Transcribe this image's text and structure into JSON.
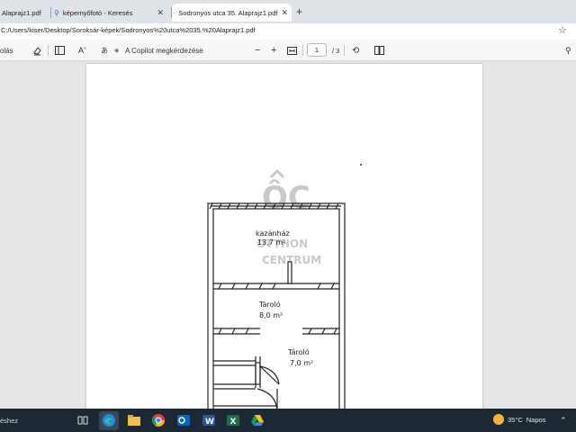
{
  "tabs": [
    {
      "label": "Alaprajz1.pdf",
      "icon": "pdf-icon",
      "active": false
    },
    {
      "label": "képernyőfotó - Keresés",
      "icon": "search-icon",
      "active": false
    },
    {
      "label": "Sodronyos utca 35. Alaprajz1.pdf",
      "icon": "pdf-icon",
      "active": true
    }
  ],
  "address": {
    "url": "C:/Users/kiser/Desktop/Soroksár-képek/Sodronyos%20utca%2035.%20Alaprajz1.pdf"
  },
  "pdf_toolbar": {
    "left_label": "olás",
    "copilot_label": "A Copilot megkérdezése",
    "zoom_out": "−",
    "zoom_in": "+",
    "page_current": "1",
    "page_total": "/ 3"
  },
  "floorplan": {
    "watermark_logo_text": "ÔC",
    "watermark_line1": "OTTHON",
    "watermark_line2": "CENTRUM",
    "room1_name": "kazánház",
    "room1_area": "13,7 m²",
    "room2_name": "Tároló",
    "room2_area": "8,0 m²",
    "room3_name": "Tároló",
    "room3_area": "7,0 m²"
  },
  "taskbar": {
    "search_text": "éshez",
    "weather_temp": "35°C",
    "weather_desc": "Napos",
    "apps": [
      "task-view-icon",
      "edge-icon",
      "file-explorer-icon",
      "chrome-icon",
      "outlook-icon",
      "word-icon",
      "excel-icon",
      "drive-icon"
    ]
  }
}
